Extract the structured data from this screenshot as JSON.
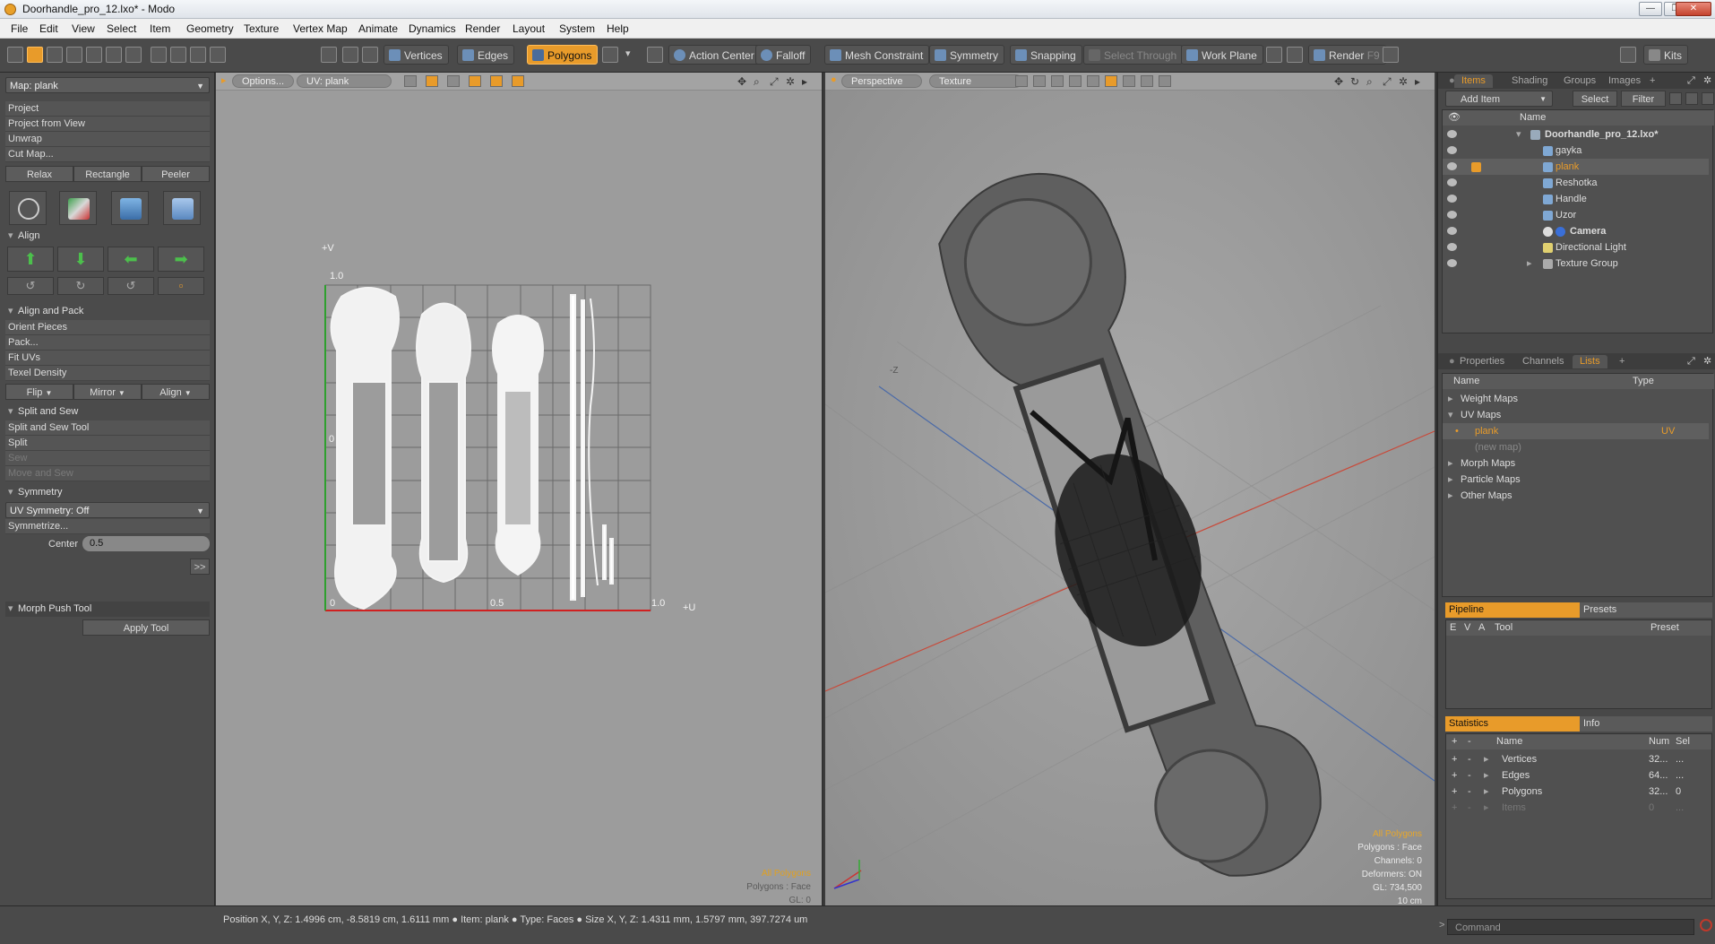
{
  "window": {
    "title": "Doorhandle_pro_12.lxo* - Modo"
  },
  "menu": [
    "File",
    "Edit",
    "View",
    "Select",
    "Item",
    "Geometry",
    "Texture",
    "Vertex Map",
    "Animate",
    "Dynamics",
    "Render",
    "Layout",
    "System",
    "Help"
  ],
  "toolbar": {
    "vertices": "Vertices",
    "edges": "Edges",
    "polygons": "Polygons",
    "action_center": "Action Center",
    "falloff": "Falloff",
    "mesh_constraint": "Mesh Constraint",
    "symmetry": "Symmetry",
    "snapping": "Snapping",
    "select_through": "Select Through",
    "work_plane": "Work Plane",
    "render": "Render",
    "render_key": "F9",
    "kits": "Kits"
  },
  "left": {
    "map_select": "Map: plank",
    "project_items": [
      "Project",
      "Project from View",
      "Unwrap",
      "Cut Map..."
    ],
    "relax": "Relax",
    "rectangle": "Rectangle",
    "peeler": "Peeler",
    "align_header": "Align",
    "align_pack_header": "Align and Pack",
    "align_pack_items": [
      "Orient Pieces",
      "Pack...",
      "Fit UVs",
      "Texel Density"
    ],
    "flip": "Flip",
    "mirror": "Mirror",
    "align": "Align",
    "split_sew_header": "Split and Sew",
    "split_sew_items": [
      "Split and Sew Tool",
      "Split",
      "Sew",
      "Move and Sew"
    ],
    "symmetry_header": "Symmetry",
    "uv_symmetry": "UV Symmetry: Off",
    "symmetrize": "Symmetrize...",
    "center_label": "Center",
    "center_value": "0.5",
    "expand": ">>",
    "morph_header": "Morph Push Tool",
    "apply_tool": "Apply Tool"
  },
  "uv": {
    "options": "Options...",
    "uv_map": "UV: plank",
    "plus_v": "+V",
    "plus_u": "+U",
    "one_v": "1.0",
    "zero_v": "0",
    "zero_u": "0",
    "half_u": "0.5",
    "one_u": "1.0",
    "info1": "All Polygons",
    "info2": "Polygons : Face",
    "info3": "GL: 0"
  },
  "view3d": {
    "perspective": "Perspective",
    "texture": "Texture",
    "z_label": "-Z",
    "info1": "All Polygons",
    "info2": "Polygons : Face",
    "info3": "Channels: 0",
    "info4": "Deformers: ON",
    "info5": "GL: 734,500",
    "info6": "10 cm"
  },
  "items": {
    "tabs": [
      "Items",
      "Shading",
      "Groups",
      "Images",
      "+"
    ],
    "add_item": "Add Item",
    "select": "Select",
    "filter": "Filter",
    "col_name": "Name",
    "rows": [
      {
        "label": "Doorhandle_pro_12.lxo*"
      },
      {
        "label": "gayka"
      },
      {
        "label": "plank"
      },
      {
        "label": "Reshotka"
      },
      {
        "label": "Handle"
      },
      {
        "label": "Uzor"
      },
      {
        "label": "Camera"
      },
      {
        "label": "Directional Light"
      },
      {
        "label": "Texture Group"
      }
    ]
  },
  "lists": {
    "tabs": [
      "Properties",
      "Channels",
      "Lists",
      "+"
    ],
    "col_name": "Name",
    "col_type": "Type",
    "rows": [
      {
        "label": "Weight Maps",
        "type": ""
      },
      {
        "label": "UV Maps",
        "type": ""
      },
      {
        "label": "plank",
        "type": "UV"
      },
      {
        "label": "(new map)",
        "type": ""
      },
      {
        "label": "Morph Maps",
        "type": ""
      },
      {
        "label": "Particle Maps",
        "type": ""
      },
      {
        "label": "Other Maps",
        "type": ""
      }
    ]
  },
  "pipeline": {
    "tab1": "Pipeline",
    "tab2": "Presets",
    "cols": [
      "E",
      "V",
      "A",
      "Tool",
      "Preset"
    ]
  },
  "stats": {
    "tab1": "Statistics",
    "tab2": "Info",
    "col_name": "Name",
    "col_num": "Num",
    "col_sel": "Sel",
    "rows": [
      {
        "label": "Vertices",
        "num": "32...",
        "sel": "..."
      },
      {
        "label": "Edges",
        "num": "64...",
        "sel": "..."
      },
      {
        "label": "Polygons",
        "num": "32...",
        "sel": "0"
      },
      {
        "label": "Items",
        "num": "0",
        "sel": "..."
      }
    ]
  },
  "status": {
    "text": "Position X, Y, Z:   1.4996 cm, -8.5819 cm, 1.6111 mm  ●  Item:  plank  ●  Type:  Faces  ●  Size X, Y, Z:   1.4311 mm, 1.5797 mm, 397.7274 um"
  },
  "command": {
    "placeholder": "Command"
  },
  "colors": {
    "accent": "#e89b2a",
    "panel": "#4b4b4b",
    "viewport": "#9c9c9c"
  }
}
